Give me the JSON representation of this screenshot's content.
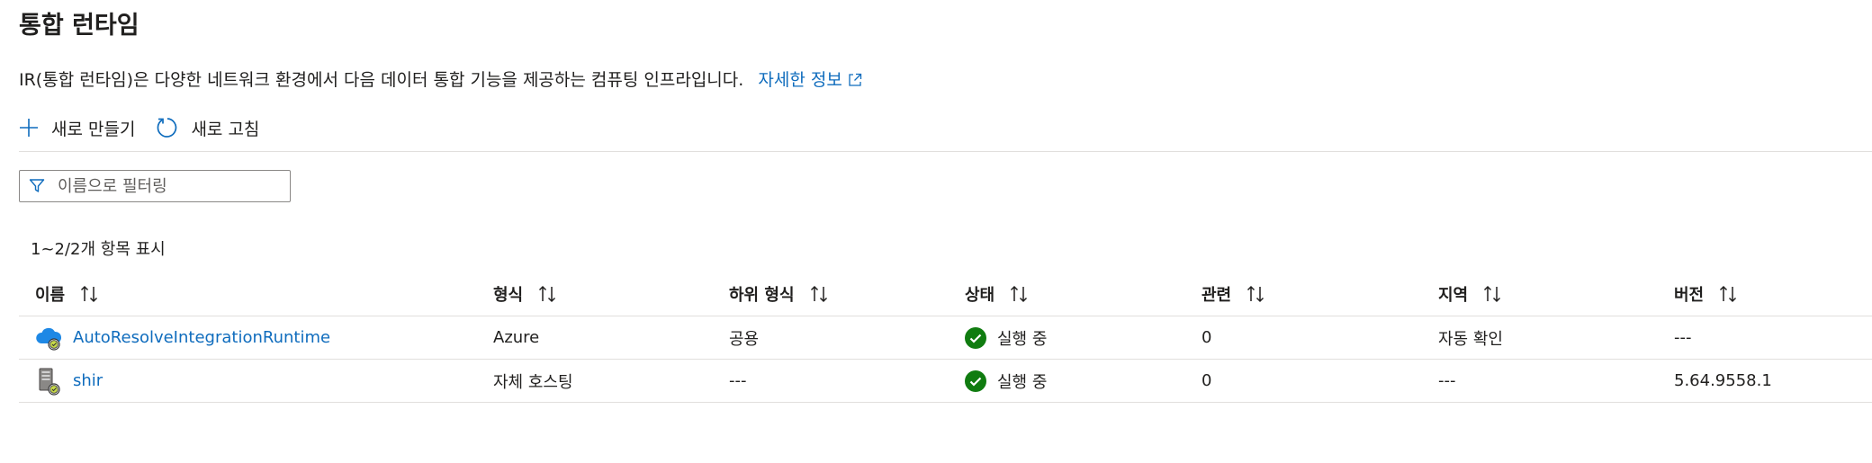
{
  "page": {
    "title": "통합 런타임",
    "description": "IR(통합 런타임)은 다양한 네트워크 환경에서 다음 데이터 통합 기능을 제공하는 컴퓨팅 인프라입니다.",
    "learn_more": "자세한 정보"
  },
  "toolbar": {
    "new_label": "새로 만들기",
    "refresh_label": "새로 고침"
  },
  "filter": {
    "placeholder": "이름으로 필터링",
    "value": ""
  },
  "list": {
    "count_text": "1~2/2개 항목 표시",
    "columns": [
      "이름",
      "형식",
      "하위 형식",
      "상태",
      "관련",
      "지역",
      "버전"
    ],
    "rows": [
      {
        "icon": "azure-cloud-runtime-icon",
        "name": "AutoResolveIntegrationRuntime",
        "type": "Azure",
        "subtype": "공용",
        "status": "실행 중",
        "related": "0",
        "region": "자동 확인",
        "version": "---"
      },
      {
        "icon": "self-hosted-server-icon",
        "name": "shir",
        "type": "자체 호스팅",
        "subtype": "---",
        "status": "실행 중",
        "related": "0",
        "region": "---",
        "version": "5.64.9558.1"
      }
    ]
  },
  "colors": {
    "link": "#0f6cbd",
    "success": "#107c10",
    "border": "#e1dfdd"
  }
}
